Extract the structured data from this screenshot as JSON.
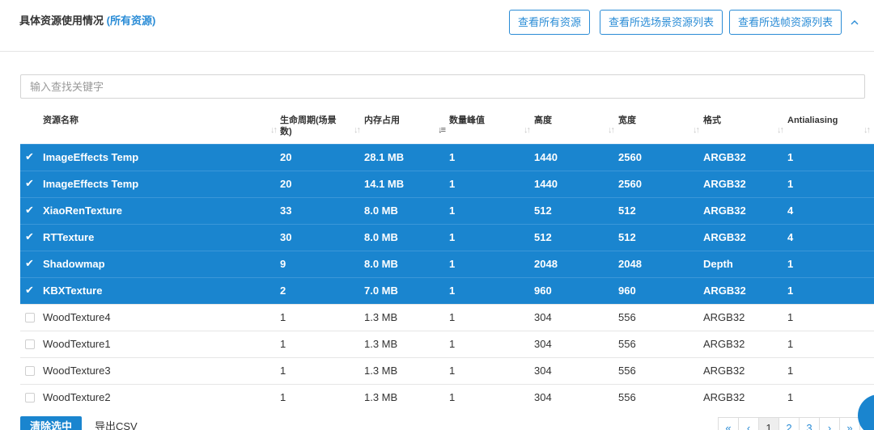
{
  "header": {
    "title": "具体资源使用情况",
    "title_link": "(所有资源)",
    "buttons": [
      "查看所有资源",
      "查看所选场景资源列表",
      "查看所选帧资源列表"
    ],
    "collapse_icon": "chevron-up-icon"
  },
  "search": {
    "placeholder": "输入查找关键字"
  },
  "table": {
    "headers": [
      "资源名称",
      "生命周期(场景数)",
      "内存占用",
      "数量峰值",
      "高度",
      "宽度",
      "格式",
      "Antialiasing"
    ],
    "header_line1": [
      "资源名称",
      "生命周期(场景",
      "内存占用",
      "数量峰值",
      "高度",
      "宽度",
      "格式",
      "Antialiasing"
    ],
    "header_line2": [
      "",
      "数)",
      "",
      "",
      "",
      "",
      "",
      ""
    ],
    "sorted_column": "内存占用",
    "rows": [
      {
        "selected": true,
        "cells": [
          "ImageEffects Temp",
          "20",
          "28.1 MB",
          "1",
          "1440",
          "2560",
          "ARGB32",
          "1"
        ]
      },
      {
        "selected": true,
        "cells": [
          "ImageEffects Temp",
          "20",
          "14.1 MB",
          "1",
          "1440",
          "2560",
          "ARGB32",
          "1"
        ]
      },
      {
        "selected": true,
        "cells": [
          "XiaoRenTexture",
          "33",
          "8.0 MB",
          "1",
          "512",
          "512",
          "ARGB32",
          "4"
        ]
      },
      {
        "selected": true,
        "cells": [
          "RTTexture",
          "30",
          "8.0 MB",
          "1",
          "512",
          "512",
          "ARGB32",
          "4"
        ]
      },
      {
        "selected": true,
        "cells": [
          "Shadowmap",
          "9",
          "8.0 MB",
          "1",
          "2048",
          "2048",
          "Depth",
          "1"
        ]
      },
      {
        "selected": true,
        "cells": [
          "KBXTexture",
          "2",
          "7.0 MB",
          "1",
          "960",
          "960",
          "ARGB32",
          "1"
        ]
      },
      {
        "selected": false,
        "cells": [
          "WoodTexture4",
          "1",
          "1.3 MB",
          "1",
          "304",
          "556",
          "ARGB32",
          "1"
        ]
      },
      {
        "selected": false,
        "cells": [
          "WoodTexture1",
          "1",
          "1.3 MB",
          "1",
          "304",
          "556",
          "ARGB32",
          "1"
        ]
      },
      {
        "selected": false,
        "cells": [
          "WoodTexture3",
          "1",
          "1.3 MB",
          "1",
          "304",
          "556",
          "ARGB32",
          "1"
        ]
      },
      {
        "selected": false,
        "cells": [
          "WoodTexture2",
          "1",
          "1.3 MB",
          "1",
          "304",
          "556",
          "ARGB32",
          "1"
        ]
      }
    ]
  },
  "footer": {
    "clear_label": "清除选中",
    "csv_label": "导出CSV"
  },
  "pagination": {
    "items": [
      "«",
      "‹",
      "1",
      "2",
      "3",
      "›",
      "»"
    ],
    "current": "1"
  },
  "colors": {
    "accent": "#1a85cf",
    "link": "#2a8cd6"
  }
}
